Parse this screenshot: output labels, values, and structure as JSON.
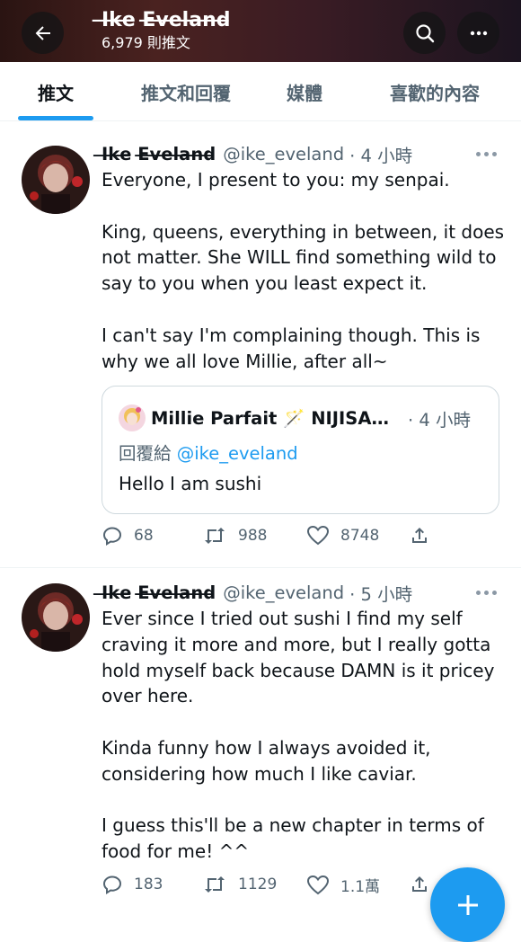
{
  "header": {
    "title": "I̶k̶e̶ E̶v̶e̶l̶a̶n̶d̶",
    "tweet_count": "6,979 則推文",
    "back_icon": "arrow-left-icon",
    "search_icon": "search-icon",
    "more_icon": "more-horizontal-icon"
  },
  "tabs": [
    {
      "label": "推文",
      "active": true
    },
    {
      "label": "推文和回覆",
      "active": false
    },
    {
      "label": "媒體",
      "active": false
    },
    {
      "label": "喜歡的內容",
      "active": false
    }
  ],
  "tweets": [
    {
      "name": "I̶k̶e̶ E̶v̶e̶l̶a̶n̶d̶",
      "handle": "@ike_eveland",
      "time": "· 4 小時",
      "text": "Everyone, I present to you: my senpai.\n\nKing, queens, everything in between, it does not matter. She WILL find something wild to say to you when you least expect it.\n\nI can't say I'm complaining though. This is why we all love Millie, after all~",
      "quote": {
        "name": "Millie Parfait 🪄 NIJISANJI EN",
        "time": "· 4 小時",
        "reply_prefix": "回覆給",
        "reply_mention": "@ike_eveland",
        "text": "Hello I am sushi"
      },
      "replies": "68",
      "retweets": "988",
      "likes": "8748"
    },
    {
      "name": "I̶k̶e̶ E̶v̶e̶l̶a̶n̶d̶",
      "handle": "@ike_eveland",
      "time": "· 5 小時",
      "text": "Ever since I tried out sushi I find my self craving it more and more, but I really gotta hold myself back because DAMN is it pricey over here.\n\nKinda funny how I always avoided it, considering how much I like caviar.\n\nI guess this'll be a new chapter in terms of food for me! ^^",
      "replies": "183",
      "retweets": "1129",
      "likes": "1.1萬"
    }
  ],
  "colors": {
    "accent": "#1d9bf0",
    "muted": "#536471",
    "text": "#0f1419"
  }
}
